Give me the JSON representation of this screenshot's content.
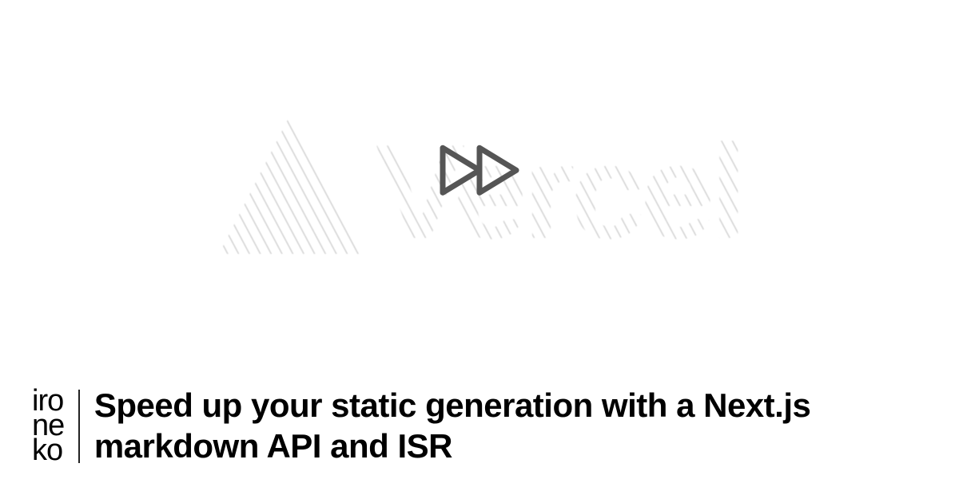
{
  "hero": {
    "background_brand": "Vercel",
    "icon_name": "fast-forward"
  },
  "footer": {
    "logo": {
      "line1": "iro",
      "line2": "ne",
      "line3": "ko"
    },
    "title": "Speed up your static generation with a Next.js markdown API and ISR"
  },
  "colors": {
    "background": "#ffffff",
    "text": "#000000",
    "icon_stroke": "#555555"
  }
}
